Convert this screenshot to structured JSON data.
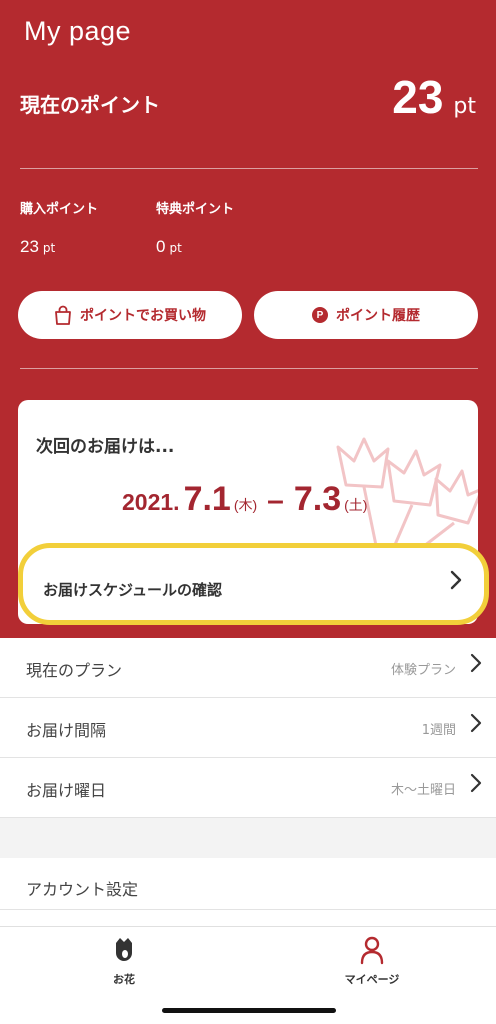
{
  "header": {
    "title": "My page",
    "current_points_label": "現在のポイント",
    "current_points_value": "23",
    "current_points_unit": "pt"
  },
  "points": {
    "purchase": {
      "label": "購入ポイント",
      "value": "23",
      "unit": "pt"
    },
    "bonus": {
      "label": "特典ポイント",
      "value": "0",
      "unit": "pt"
    }
  },
  "actions": {
    "shop_label": "ポイントでお買い物",
    "shop_icon": "shopping-bag-icon",
    "history_label": "ポイント履歴",
    "history_icon_letter": "P"
  },
  "delivery": {
    "title": "次回のお届けは...",
    "year": "2021.",
    "start_date": "7.1",
    "start_weekday": "(木)",
    "dash": "–",
    "end_date": "7.3",
    "end_weekday": "(土)",
    "schedule_label": "お届けスケジュールの確認"
  },
  "settings": [
    {
      "label": "現在のプラン",
      "value": "体験プラン"
    },
    {
      "label": "お届け間隔",
      "value": "1週間"
    },
    {
      "label": "お届け曜日",
      "value": "木〜土曜日"
    }
  ],
  "account": {
    "label": "アカウント設定"
  },
  "tabs": [
    {
      "label": "お花",
      "icon": "flower-icon",
      "color": "#333333"
    },
    {
      "label": "マイページ",
      "icon": "person-icon",
      "color": "#b42a2f"
    }
  ],
  "colors": {
    "brand": "#b42a2f",
    "highlight": "#f2cf3a",
    "date_text": "#a32630"
  }
}
